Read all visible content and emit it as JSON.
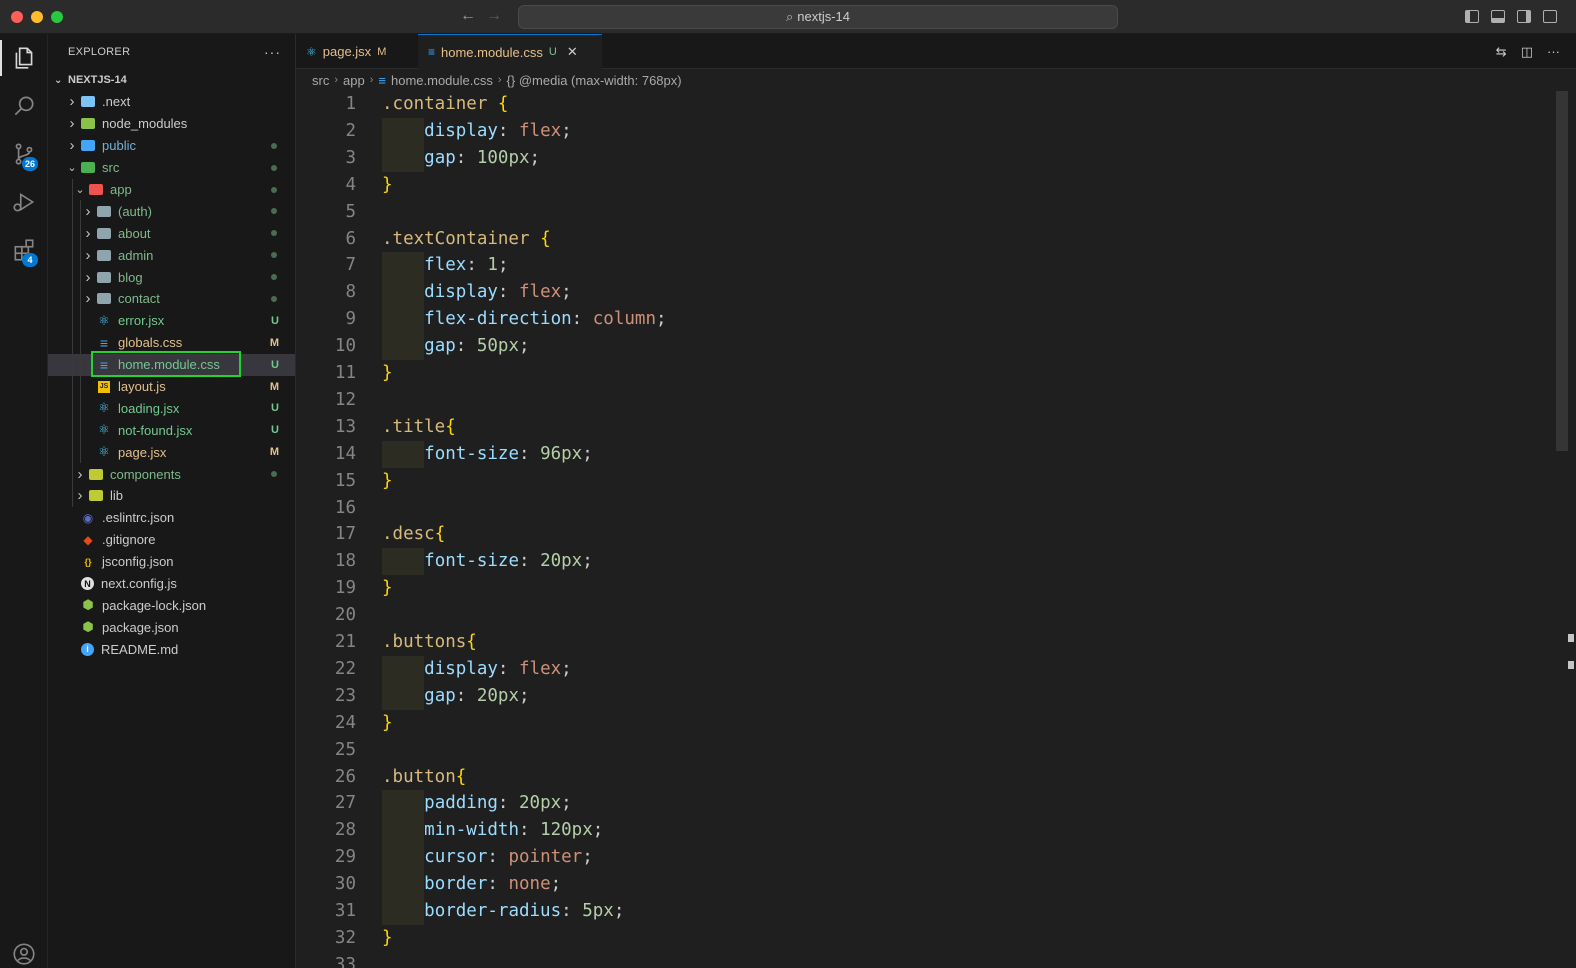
{
  "window": {
    "search_label": "nextjs-14"
  },
  "activity_bar": {
    "source_control_badge": "26",
    "extensions_badge": "4"
  },
  "sidebar": {
    "header": "EXPLORER",
    "more": "···",
    "root": "NEXTJS-14",
    "items": [
      {
        "name": ".next",
        "depth": 0,
        "kind": "folder",
        "expanded": false,
        "color": "#7cc4f5",
        "status": ""
      },
      {
        "name": "node_modules",
        "depth": 0,
        "kind": "folder",
        "expanded": false,
        "color": "#8bc34a",
        "status": ""
      },
      {
        "name": "public",
        "depth": 0,
        "kind": "folder",
        "expanded": false,
        "color": "#42a5f5",
        "status": "dot"
      },
      {
        "name": "src",
        "depth": 0,
        "kind": "folder",
        "expanded": true,
        "color": "#4caf50",
        "status": "dot"
      },
      {
        "name": "app",
        "depth": 1,
        "kind": "folder",
        "expanded": true,
        "color": "#ef5350",
        "status": "dot"
      },
      {
        "name": "(auth)",
        "depth": 2,
        "kind": "folder",
        "expanded": false,
        "color": "#90a4ae",
        "status": "dot"
      },
      {
        "name": "about",
        "depth": 2,
        "kind": "folder",
        "expanded": false,
        "color": "#90a4ae",
        "status": "dot"
      },
      {
        "name": "admin",
        "depth": 2,
        "kind": "folder",
        "expanded": false,
        "color": "#90a4ae",
        "status": "dot"
      },
      {
        "name": "blog",
        "depth": 2,
        "kind": "folder",
        "expanded": false,
        "color": "#90a4ae",
        "status": "dot"
      },
      {
        "name": "contact",
        "depth": 2,
        "kind": "folder",
        "expanded": false,
        "color": "#90a4ae",
        "status": "dot"
      },
      {
        "name": "error.jsx",
        "depth": 2,
        "kind": "react",
        "status": "U"
      },
      {
        "name": "globals.css",
        "depth": 2,
        "kind": "css",
        "status": "M"
      },
      {
        "name": "home.module.css",
        "depth": 2,
        "kind": "css",
        "status": "U",
        "selected": true
      },
      {
        "name": "layout.js",
        "depth": 2,
        "kind": "js",
        "status": "M"
      },
      {
        "name": "loading.jsx",
        "depth": 2,
        "kind": "react",
        "status": "U"
      },
      {
        "name": "not-found.jsx",
        "depth": 2,
        "kind": "react",
        "status": "U"
      },
      {
        "name": "page.jsx",
        "depth": 2,
        "kind": "react",
        "status": "M"
      },
      {
        "name": "components",
        "depth": 1,
        "kind": "folder",
        "expanded": false,
        "color": "#c0ca33",
        "status": "dot"
      },
      {
        "name": "lib",
        "depth": 1,
        "kind": "folder",
        "expanded": false,
        "color": "#c0ca33",
        "status": ""
      },
      {
        "name": ".eslintrc.json",
        "depth": 0,
        "kind": "eslint",
        "status": ""
      },
      {
        "name": ".gitignore",
        "depth": 0,
        "kind": "git",
        "status": ""
      },
      {
        "name": "jsconfig.json",
        "depth": 0,
        "kind": "jsconfig",
        "status": ""
      },
      {
        "name": "next.config.js",
        "depth": 0,
        "kind": "next",
        "status": ""
      },
      {
        "name": "package-lock.json",
        "depth": 0,
        "kind": "npm",
        "status": ""
      },
      {
        "name": "package.json",
        "depth": 0,
        "kind": "npm",
        "status": ""
      },
      {
        "name": "README.md",
        "depth": 0,
        "kind": "info",
        "status": ""
      }
    ]
  },
  "tabs": [
    {
      "label": "page.jsx",
      "status": "M",
      "active": false
    },
    {
      "label": "home.module.css",
      "status": "U",
      "active": true
    }
  ],
  "breadcrumb": [
    "src",
    "app",
    "home.module.css",
    "{} @media (max-width: 768px)"
  ],
  "code_lines": [
    ".container {",
    "    display: flex;",
    "    gap: 100px;",
    "}",
    "",
    ".textContainer {",
    "    flex: 1;",
    "    display: flex;",
    "    flex-direction: column;",
    "    gap: 50px;",
    "}",
    "",
    ".title{",
    "    font-size: 96px;",
    "}",
    "",
    ".desc{",
    "    font-size: 20px;",
    "}",
    "",
    ".buttons{",
    "    display: flex;",
    "    gap: 20px;",
    "}",
    "",
    ".button{",
    "    padding: 20px;",
    "    min-width: 120px;",
    "    cursor: pointer;",
    "    border: none;",
    "    border-radius: 5px;",
    "}",
    ""
  ],
  "colors": {
    "modified": "#e2c08d",
    "untracked": "#73c991",
    "accent": "#0078d4",
    "highlight_box": "#22d430"
  }
}
